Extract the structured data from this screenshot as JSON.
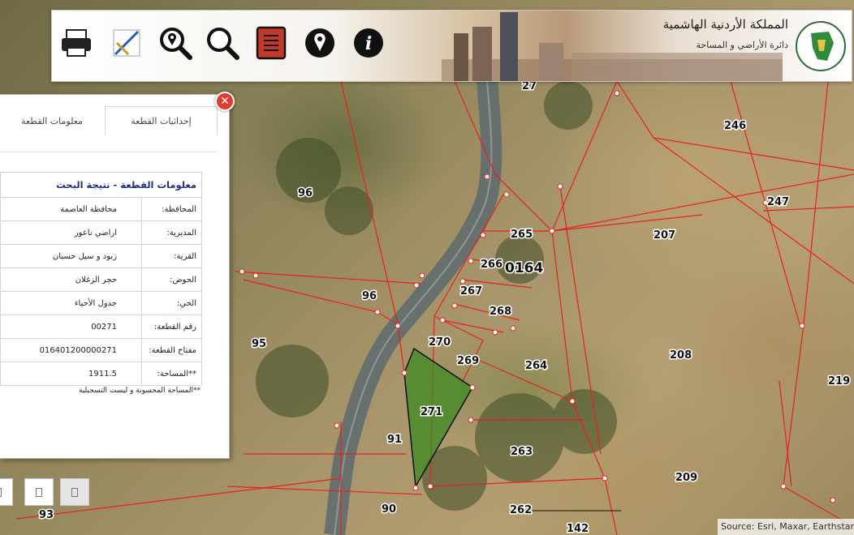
{
  "header": {
    "title": "المملكة الأردنية الهاشمية",
    "subtitle": "دائرة الأراضي و المساحة",
    "tools": [
      "print-icon",
      "draw-measure-icon",
      "search-location-icon",
      "zoom-search-icon",
      "report-book-icon",
      "location-pin-icon",
      "info-icon"
    ]
  },
  "panel": {
    "tabs": {
      "coordinates": "إحداثيات القطعة",
      "info": "معلومات القطعة"
    },
    "title": "معلومات القطعة - نتيجة البحث",
    "rows": [
      {
        "key": "المحافظة:",
        "value": "محافظة العاصمة"
      },
      {
        "key": "المديرية:",
        "value": "اراضي ناعور"
      },
      {
        "key": "القرية:",
        "value": "زبود و سيل حسبان"
      },
      {
        "key": "الحوض:",
        "value": "حجر الزغلان"
      },
      {
        "key": "الحي:",
        "value": "جدول الأحياء"
      },
      {
        "key": "رقم القطعة:",
        "value": "00271"
      },
      {
        "key": "مفتاح القطعة:",
        "value": "016401200000271"
      },
      {
        "key": "**المساحة:",
        "value": "1911.5"
      }
    ],
    "note": "**المساحة المحسوبة و ليست التسجيلية",
    "close": "✕"
  },
  "map": {
    "block_label": "0164",
    "parcel_labels": [
      "27",
      "246",
      "96",
      "247",
      "265",
      "207",
      "266",
      "96",
      "267",
      "268",
      "95",
      "270",
      "208",
      "269",
      "264",
      "219",
      "271",
      "91",
      "263",
      "209",
      "90",
      "262",
      "93",
      "142"
    ],
    "selected_parcel": "271",
    "attribution": "Source: Esri, Maxar, Earthstar"
  },
  "colors": {
    "boundary": "#e8221b",
    "selected_fill": "#3d8a22",
    "panel_title": "#1b2f83",
    "close_button": "#e03c31"
  }
}
